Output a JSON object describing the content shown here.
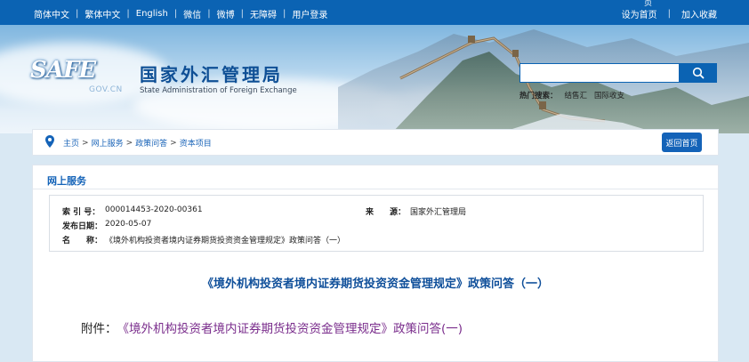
{
  "topbar": {
    "languages": [
      "简体中文",
      "繁体中文",
      "English",
      "微信",
      "微博",
      "无障碍",
      "用户登录"
    ],
    "set_home": "设为首页",
    "favorite": "加入收藏",
    "stray_glyph": "页"
  },
  "header": {
    "logo_safe": "SAFE",
    "logo_gov": "GOV.CN",
    "name_cn": "国家外汇管理局",
    "name_en": "State Administration of Foreign Exchange"
  },
  "search": {
    "placeholder": "",
    "quick_label": "热门搜索：",
    "quick_links": [
      "结售汇",
      "国际收支"
    ]
  },
  "breadcrumb": {
    "items": [
      "主页",
      "网上服务",
      "政策问答",
      "资本项目"
    ],
    "separator": ">",
    "home_button": "返回首页"
  },
  "content": {
    "section_title": "网上服务",
    "meta": {
      "index_label": "索 引 号：",
      "index_value": "000014453-2020-00361",
      "source_label": "来　　源：",
      "source_value": "国家外汇管理局",
      "date_label": "发布日期：",
      "date_value": "2020-05-07",
      "name_label": "名　　称：",
      "name_value": "《境外机构投资者境内证券期货投资资金管理规定》政策问答（一）"
    },
    "doc_title": "《境外机构投资者境内证券期货投资资金管理规定》政策问答（一）",
    "attachment_label": "附件：",
    "attachment_link": "《境外机构投资者境内证券期货投资资金管理规定》政策问答(一)"
  },
  "colors": {
    "brand_blue": "#0b63b3",
    "title_blue": "#0f4f9a",
    "link_purple": "#7a2d8c"
  }
}
